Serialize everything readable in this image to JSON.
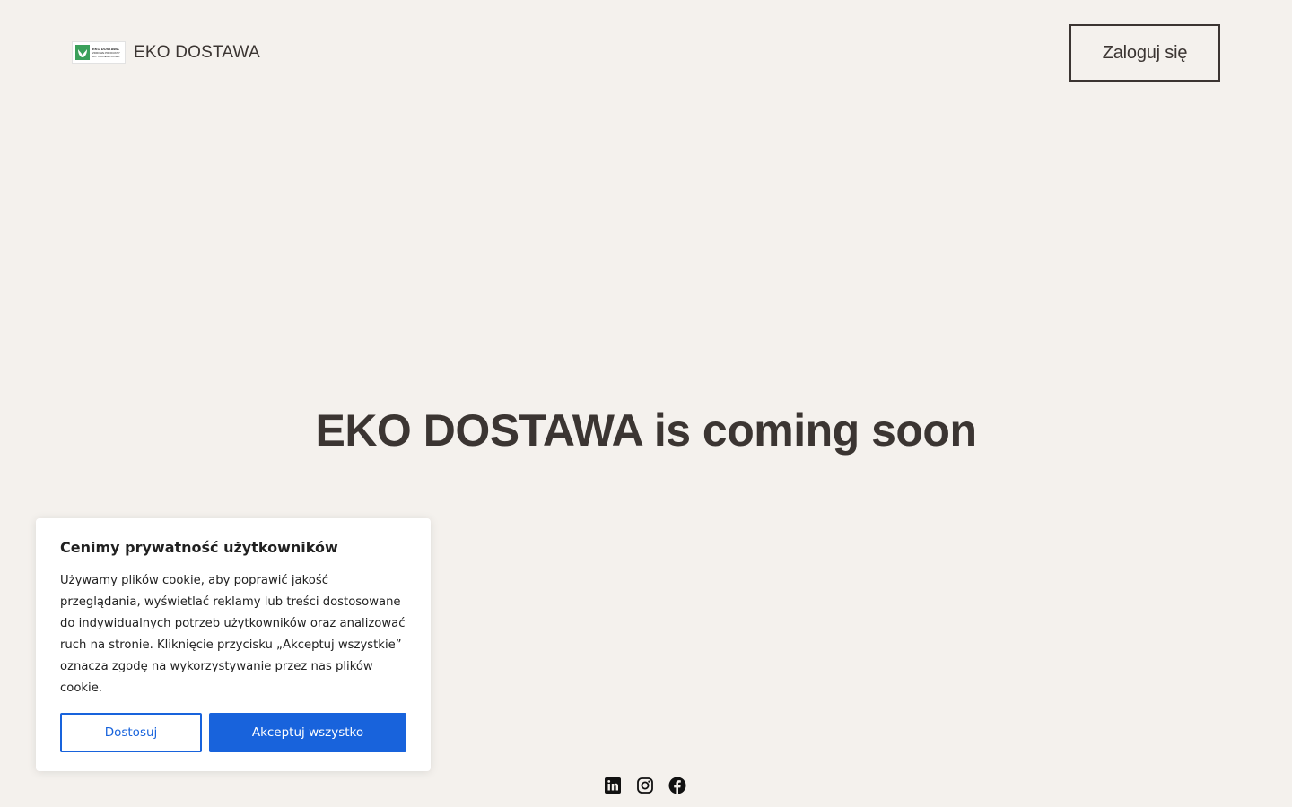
{
  "header": {
    "logo_lines": [
      "EKO DOSTAWA",
      "ZDROWE PRODUKTY",
      "DO TWOJEGO DOMU"
    ],
    "brand_name": "EKO DOSTAWA",
    "login_label": "Zaloguj się"
  },
  "hero": {
    "title": "EKO DOSTAWA is coming soon"
  },
  "social": {
    "icons": [
      "linkedin-icon",
      "instagram-icon",
      "facebook-icon"
    ]
  },
  "cookie_banner": {
    "title": "Cenimy prywatność użytkowników",
    "text": "Używamy plików cookie, aby poprawić jakość przeglądania, wyświetlać reklamy lub treści dostosowane do indywidualnych potrzeb użytkowników oraz analizować ruch na stronie. Kliknięcie przycisku „Akceptuj wszystkie” oznacza zgodę na wykorzystywanie przez nas plików cookie.",
    "customize_label": "Dostosuj",
    "accept_label": "Akceptuj wszystko"
  },
  "colors": {
    "background": "#f4f1ed",
    "text": "#3b3532",
    "accent_blue": "#1863dc",
    "logo_green": "#3aa05a"
  }
}
